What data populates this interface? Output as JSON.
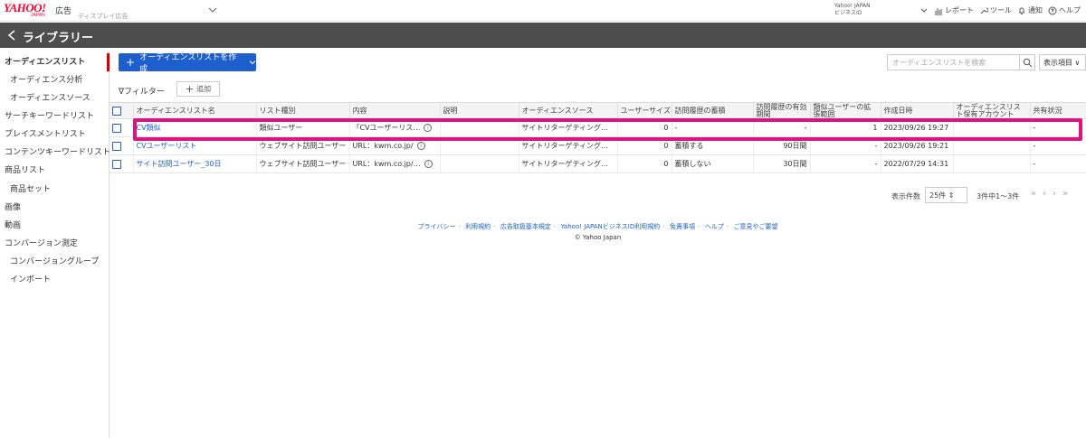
{
  "header": {
    "logo": "YAHOO!",
    "logo_sub": "JAPAN",
    "logo_ad": "広告",
    "account_type": "ディスプレイ広告",
    "account_name_line1": "Yahoo! JAPAN",
    "account_name_line2": "ビジネスID",
    "nav": {
      "report": "レポート",
      "tools": "ツール",
      "notice": "通知",
      "help": "ヘルプ"
    }
  },
  "page_title": "ライブラリー",
  "sidebar": {
    "items": [
      {
        "label": "オーディエンスリスト"
      },
      {
        "label": "オーディエンス分析"
      },
      {
        "label": "オーディエンスソース"
      },
      {
        "label": "サーチキーワードリスト"
      },
      {
        "label": "プレイスメントリスト"
      },
      {
        "label": "コンテンツキーワードリスト"
      },
      {
        "label": "商品リスト"
      },
      {
        "label": "商品セット"
      },
      {
        "label": "画像"
      },
      {
        "label": "動画"
      },
      {
        "label": "コンバージョン測定"
      },
      {
        "label": "コンバージョングループ"
      },
      {
        "label": "インポート"
      }
    ]
  },
  "toolbar": {
    "create_label": "オーディエンスリストを作成",
    "search_placeholder": "オーディエンスリストを検索",
    "display_items": "表示項目",
    "filter_label": "フィルター",
    "add_label": "追加"
  },
  "table": {
    "headers": [
      "オーディエンスリスト名",
      "リスト種別",
      "内容",
      "説明",
      "オーディエンスソース",
      "ユーザーサイズ",
      "訪問履歴の蓄積",
      "訪問履歴の有効期間",
      "類似ユーザーの拡張範囲",
      "作成日時",
      "オーディエンスリスト保有アカウント",
      "共有状況"
    ],
    "rows": [
      {
        "name": "CV類似",
        "type": "類似ユーザー",
        "content": "「CVユーザーリス…",
        "desc": "",
        "source": "サイトリターゲティングタグ",
        "size": "0",
        "accumulate": "-",
        "period": "-",
        "range": "1",
        "created": "2023/09/26 19:27",
        "owner": "",
        "share": "-"
      },
      {
        "name": "CVユーザーリスト",
        "type": "ウェブサイト訪問ユーザー",
        "content": "URL：kwm.co.jp/",
        "desc": "",
        "source": "サイトリターゲティングタグ",
        "size": "0",
        "accumulate": "蓄積する",
        "period": "90日間",
        "range": "-",
        "created": "2023/09/26 19:21",
        "owner": "",
        "share": "-"
      },
      {
        "name": "サイト訪問ユーザー_30日",
        "type": "ウェブサイト訪問ユーザー",
        "content": "URL：kwm.co.jp/…",
        "desc": "",
        "source": "サイトリターゲティングタグ",
        "size": "0",
        "accumulate": "蓄積しない",
        "period": "30日間",
        "range": "-",
        "created": "2022/07/29 14:31",
        "owner": "",
        "share": "-"
      }
    ]
  },
  "pager": {
    "label": "表示件数",
    "per_page": "25件",
    "range": "3件中1～3件"
  },
  "footer": {
    "links": [
      "プライバシー",
      "利用規約",
      "広告取扱基本規定",
      "Yahoo! JAPANビジネスID利用規約",
      "免責事項",
      "ヘルプ",
      "ご意見やご要望"
    ],
    "copyright": "© Yahoo Japan"
  },
  "colors": {
    "accent": "#1e5fce",
    "highlight": "#e0127f",
    "active_marker": "#d70000",
    "titlebar": "#4d4d4d"
  }
}
